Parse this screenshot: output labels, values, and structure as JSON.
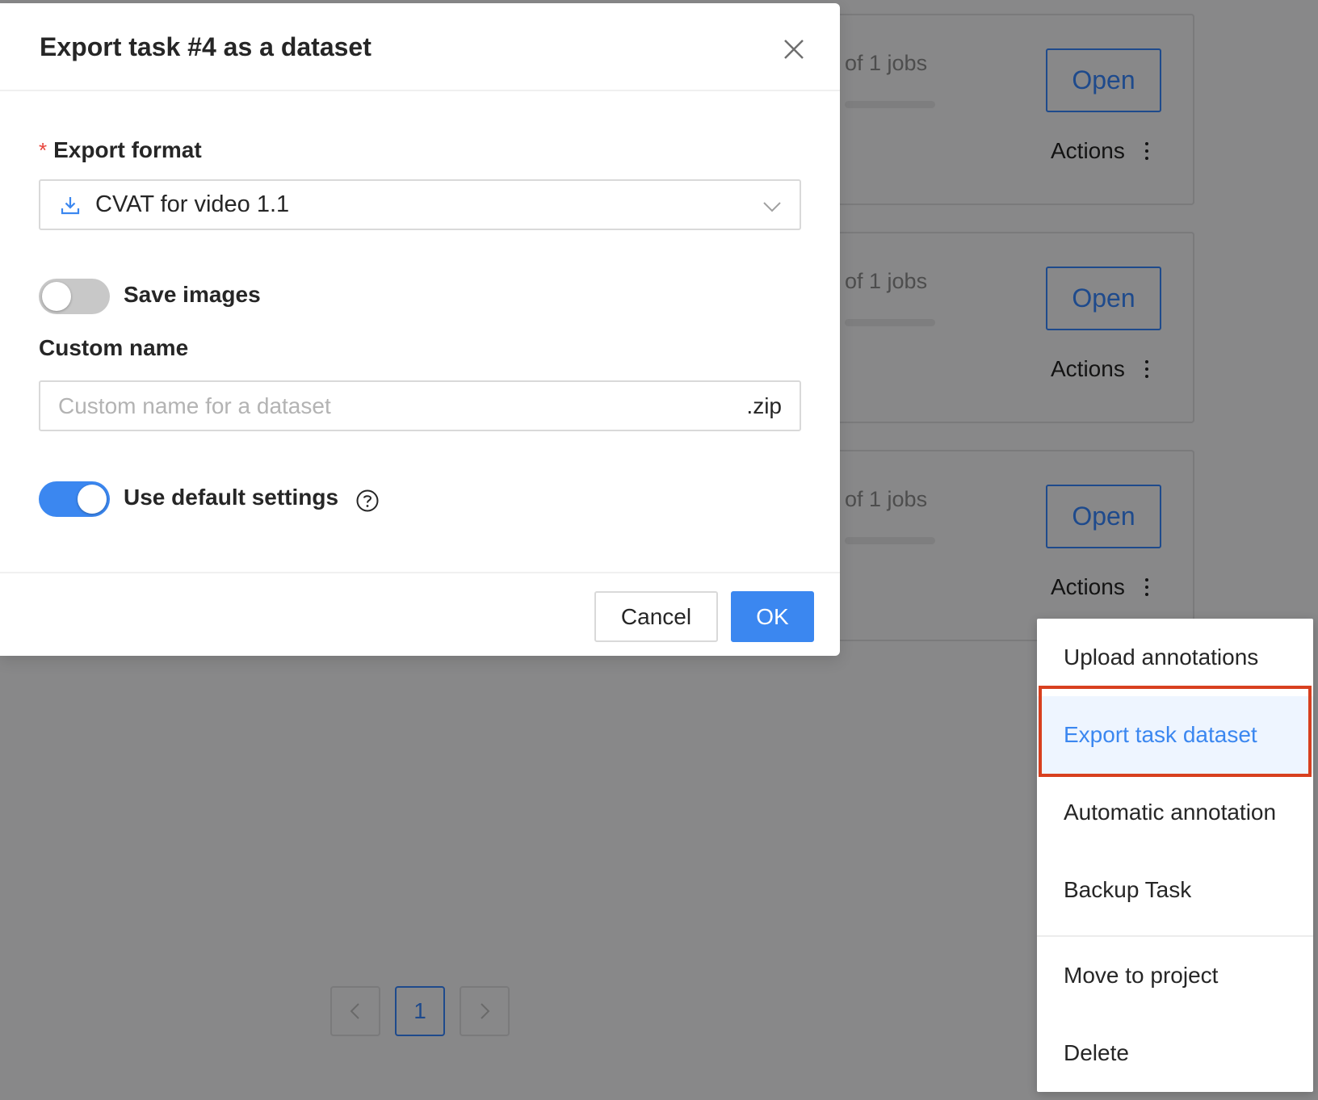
{
  "modal": {
    "title": "Export task #4 as a dataset",
    "export_format": {
      "label": "Export format",
      "required_mark": "*",
      "selected": "CVAT for video 1.1"
    },
    "save_images": {
      "label": "Save images",
      "checked": false
    },
    "custom_name": {
      "label": "Custom name",
      "placeholder": "Custom name for a dataset",
      "value": "",
      "suffix": ".zip"
    },
    "use_default_settings": {
      "label": "Use default settings",
      "checked": true
    },
    "footer": {
      "cancel_label": "Cancel",
      "ok_label": "OK"
    }
  },
  "task_cards": [
    {
      "jobs_text": "of 1 jobs",
      "open_label": "Open",
      "actions_label": "Actions"
    },
    {
      "jobs_text": "of 1 jobs",
      "open_label": "Open",
      "actions_label": "Actions"
    },
    {
      "jobs_text": "of 1 jobs",
      "open_label": "Open",
      "actions_label": "Actions"
    }
  ],
  "actions_menu": {
    "items": [
      "Upload annotations",
      "Export task dataset",
      "Automatic annotation",
      "Backup Task",
      "Move to project",
      "Delete"
    ],
    "selected": "Export task dataset"
  },
  "pagination": {
    "prev": "<",
    "current": "1",
    "next": ">"
  },
  "colors": {
    "primary": "#3b87f0",
    "overlay_bg": "#888889",
    "highlight_border": "#d8401f",
    "required": "#e8453c"
  },
  "icons": {
    "close": "close-icon",
    "download": "download-icon",
    "select_arrow": "chevron-down-icon",
    "help": "question-circle-icon",
    "more": "more-vertical-icon",
    "prev": "chevron-left-icon",
    "next": "chevron-right-icon"
  }
}
